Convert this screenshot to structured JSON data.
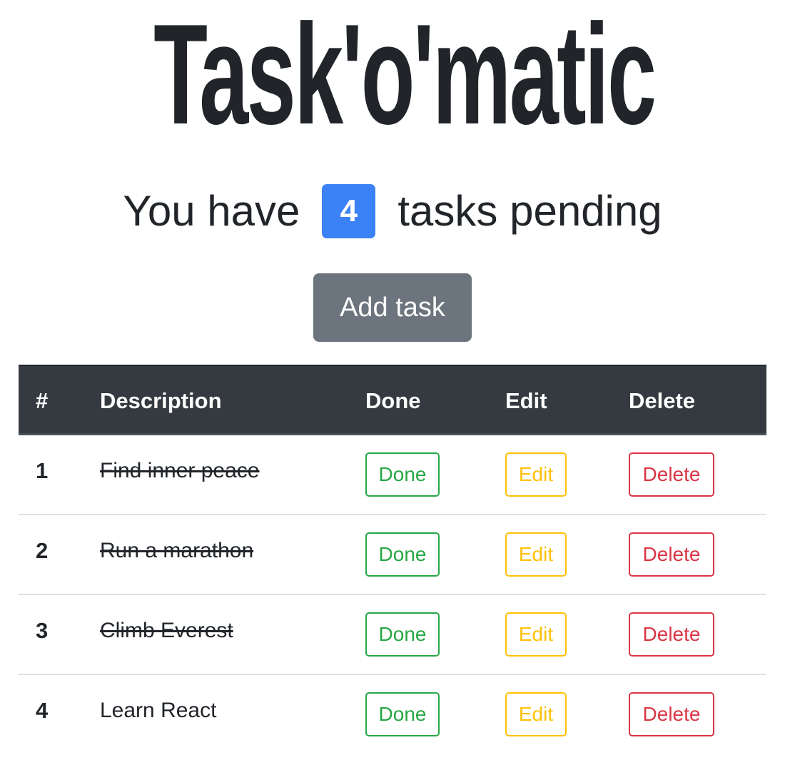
{
  "app": {
    "title": "Task'o'matic"
  },
  "pending": {
    "prefix": "You have",
    "count": "4",
    "suffix": "tasks pending"
  },
  "add_button": {
    "label": "Add task"
  },
  "table": {
    "headers": {
      "number": "#",
      "description": "Description",
      "done": "Done",
      "edit": "Edit",
      "delete": "Delete"
    },
    "rows": [
      {
        "number": "1",
        "description": "Find inner peace",
        "completed": true,
        "done_label": "Done",
        "edit_label": "Edit",
        "delete_label": "Delete"
      },
      {
        "number": "2",
        "description": "Run a marathon",
        "completed": true,
        "done_label": "Done",
        "edit_label": "Edit",
        "delete_label": "Delete"
      },
      {
        "number": "3",
        "description": "Climb Everest",
        "completed": true,
        "done_label": "Done",
        "edit_label": "Edit",
        "delete_label": "Delete"
      },
      {
        "number": "4",
        "description": "Learn React",
        "completed": false,
        "done_label": "Done",
        "edit_label": "Edit",
        "delete_label": "Delete"
      }
    ]
  },
  "colors": {
    "badge": "#3b82f6",
    "add_button": "#6c757d",
    "header_bg": "#343a40",
    "done": "#28a745",
    "edit": "#ffc107",
    "delete": "#dc3545"
  }
}
